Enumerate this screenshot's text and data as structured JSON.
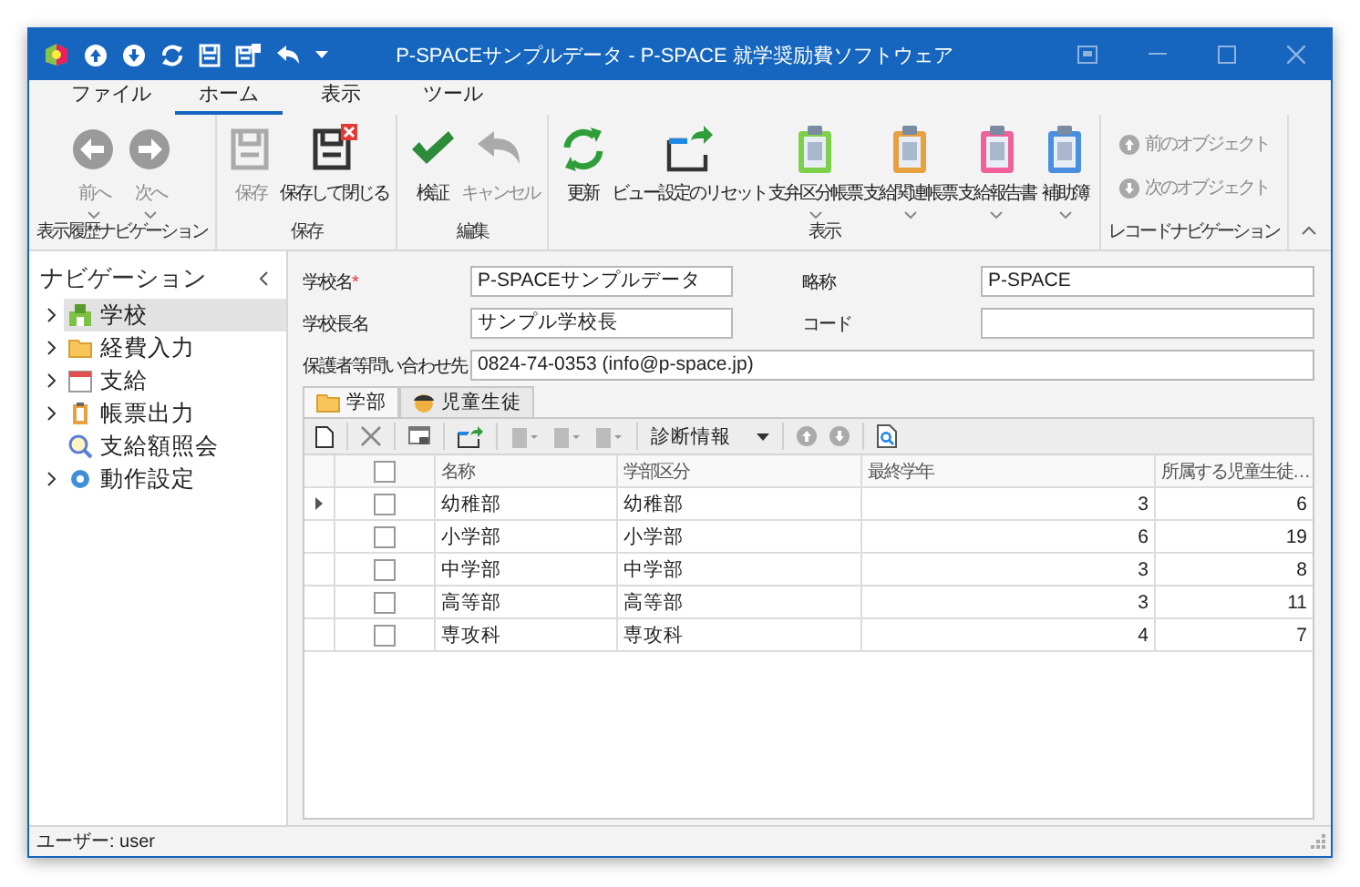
{
  "window": {
    "title": "P-SPACEサンプルデータ - P-SPACE 就学奨励費ソフトウェア"
  },
  "ribbon_tabs": [
    {
      "label": "ファイル",
      "selected": false
    },
    {
      "label": "ホーム",
      "selected": true
    },
    {
      "label": "表示",
      "selected": false
    },
    {
      "label": "ツール",
      "selected": false
    }
  ],
  "ribbon_groups": [
    {
      "label": "表示履歴ナビゲーション",
      "buttons": [
        {
          "kind": "back",
          "label": "前へ",
          "disabled": true,
          "dropdown": true
        },
        {
          "kind": "forward",
          "label": "次へ",
          "disabled": true,
          "dropdown": true
        }
      ]
    },
    {
      "label": "保存",
      "buttons": [
        {
          "kind": "save",
          "label": "保存",
          "disabled": true,
          "dropdown": false
        },
        {
          "kind": "save-close",
          "label": "保存して閉じる",
          "disabled": false,
          "dropdown": false
        }
      ]
    },
    {
      "label": "編集",
      "buttons": [
        {
          "kind": "check",
          "label": "検証",
          "disabled": false,
          "dropdown": false
        },
        {
          "kind": "undo",
          "label": "キャンセル",
          "disabled": true,
          "dropdown": false
        }
      ]
    },
    {
      "label": "表示",
      "buttons": [
        {
          "kind": "refresh",
          "label": "更新",
          "disabled": false,
          "dropdown": false
        },
        {
          "kind": "reset",
          "label": "ビュー設定のリセット",
          "disabled": false,
          "dropdown": false
        },
        {
          "kind": "report",
          "label": "支弁区分帳票",
          "color": "#7ed04b",
          "disabled": false,
          "dropdown": true
        },
        {
          "kind": "report",
          "label": "支給関連帳票",
          "color": "#e8a040",
          "disabled": false,
          "dropdown": true
        },
        {
          "kind": "report",
          "label": "支給報告書",
          "color": "#f0609a",
          "disabled": false,
          "dropdown": true
        },
        {
          "kind": "report",
          "label": "補助簿",
          "color": "#4a8ee0",
          "disabled": false,
          "dropdown": true
        }
      ]
    },
    {
      "label": "レコードナビゲーション",
      "buttons": [
        {
          "kind": "up-small",
          "label": "前のオブジェクト",
          "disabled": true
        },
        {
          "kind": "down-small",
          "label": "次のオブジェクト",
          "disabled": true
        }
      ]
    }
  ],
  "navigation": {
    "title": "ナビゲーション",
    "items": [
      {
        "label": "学校",
        "kind": "school",
        "expandable": true,
        "selected": true
      },
      {
        "label": "経費入力",
        "kind": "folder",
        "expandable": true,
        "selected": false
      },
      {
        "label": "支給",
        "kind": "calendar",
        "expandable": true,
        "selected": false
      },
      {
        "label": "帳票出力",
        "kind": "clipboard",
        "expandable": true,
        "selected": false
      },
      {
        "label": "支給額照会",
        "kind": "search",
        "expandable": false,
        "selected": false
      },
      {
        "label": "動作設定",
        "kind": "gear",
        "expandable": true,
        "selected": false
      }
    ]
  },
  "form": {
    "fields": [
      {
        "kind": "normal",
        "label": "学校名",
        "required_mark": "*",
        "value": "P-SPACEサンプルデータ"
      },
      {
        "kind": "normal",
        "label": "略称",
        "value": "P-SPACE"
      },
      {
        "kind": "normal",
        "label": "学校長名",
        "value": "サンプル学校長"
      },
      {
        "kind": "normal",
        "label": "コード"
      },
      {
        "kind": "wide",
        "label": "保護者等問い合わせ先",
        "value": "0824-74-0353 (info@p-space.jp)"
      }
    ]
  },
  "detail_tabs": [
    {
      "label": "学部",
      "kind": "folder",
      "selected": true
    },
    {
      "label": "児童生徒",
      "kind": "student",
      "selected": false
    }
  ],
  "grid_toolbar": {
    "diagnostics": "診断情報"
  },
  "grid": {
    "select_all_checked": false,
    "columns": [
      "名称",
      "学部区分",
      "最終学年",
      "所属する児童生徒…"
    ],
    "rows": [
      {
        "current": true,
        "checked": false,
        "cells": [
          "幼稚部",
          "幼稚部",
          "3",
          "6"
        ]
      },
      {
        "current": false,
        "checked": false,
        "cells": [
          "小学部",
          "小学部",
          "6",
          "19"
        ]
      },
      {
        "current": false,
        "checked": false,
        "cells": [
          "中学部",
          "中学部",
          "3",
          "8"
        ]
      },
      {
        "current": false,
        "checked": false,
        "cells": [
          "高等部",
          "高等部",
          "3",
          "11"
        ]
      },
      {
        "current": false,
        "checked": false,
        "cells": [
          "専攻科",
          "専攻科",
          "4",
          "7"
        ]
      }
    ]
  },
  "status_bar": {
    "user": "ユーザー: user"
  }
}
